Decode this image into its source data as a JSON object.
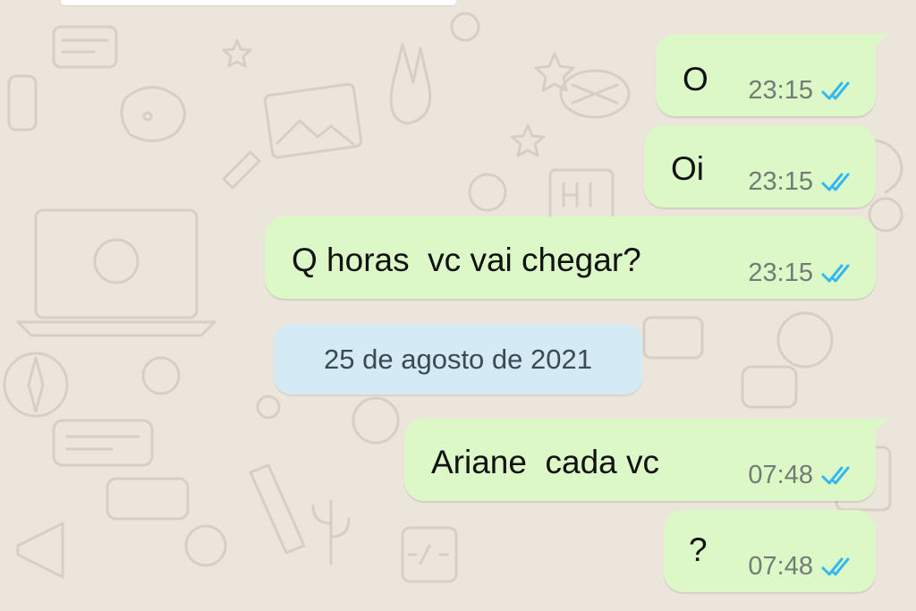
{
  "chat": {
    "messages": [
      {
        "text": "O",
        "time": "23:15",
        "status": "read"
      },
      {
        "text": "Oi",
        "time": "23:15",
        "status": "read"
      },
      {
        "text": "Q horas  vc vai chegar?",
        "time": "23:15",
        "status": "read"
      },
      {
        "text": "Ariane  cada vc",
        "time": "07:48",
        "status": "read"
      },
      {
        "text": "?",
        "time": "07:48",
        "status": "read"
      }
    ],
    "date_separator": "25 de agosto de 2021"
  },
  "colors": {
    "background": "#ece5dc",
    "outgoing_bubble": "#dcf8c6",
    "date_chip": "#d4eaf4",
    "read_ticks": "#34b7f1",
    "timestamp": "#737b77"
  },
  "icons": {
    "read_status": "double-check-icon",
    "wallpaper": "doodle-wallpaper"
  }
}
